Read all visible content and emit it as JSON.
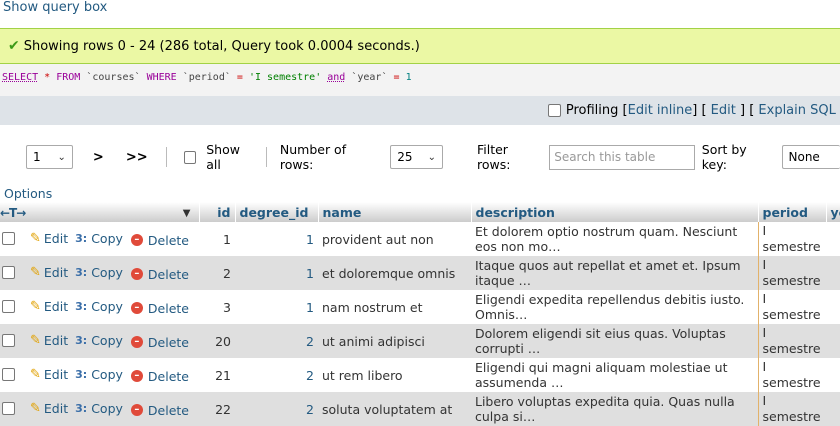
{
  "top": {
    "show_query_box": "Show query box"
  },
  "success": {
    "message": "Showing rows 0 - 24 (286 total, Query took 0.0004 seconds.)"
  },
  "sql": {
    "select": "SELECT",
    "star": "*",
    "from": "FROM",
    "table": "`courses`",
    "where": "WHERE",
    "col1": "`period`",
    "eq": "=",
    "val1": "'I semestre'",
    "and": "and",
    "col2": "`year`",
    "val2": "1"
  },
  "bar": {
    "profiling": "Profiling",
    "edit_inline": "Edit inline",
    "edit": "Edit",
    "explain": "Explain SQL"
  },
  "nav": {
    "page_value": "1",
    "next": ">",
    "last": ">>",
    "show_all": "Show all",
    "rows_label": "Number of rows:",
    "rows_value": "25",
    "filter_label": "Filter rows:",
    "filter_placeholder": "Search this table",
    "sort_label": "Sort by key:",
    "sort_value": "None"
  },
  "options_label": "Options",
  "columns": {
    "id": "id",
    "degree_id": "degree_id",
    "name": "name",
    "description": "description",
    "period": "period",
    "year": "ye"
  },
  "actions": {
    "edit": "Edit",
    "copy": "Copy",
    "delete": "Delete"
  },
  "rows": [
    {
      "id": "1",
      "degree_id": "1",
      "name": "provident aut non",
      "description": "Et dolorem optio nostrum quam. Nesciunt eos non mo…",
      "period": "I semestre"
    },
    {
      "id": "2",
      "degree_id": "1",
      "name": "et doloremque omnis",
      "description": "Itaque quos aut repellat et amet et. Ipsum itaque …",
      "period": "I semestre"
    },
    {
      "id": "3",
      "degree_id": "1",
      "name": "nam nostrum et",
      "description": "Eligendi expedita repellendus debitis iusto. Omnis…",
      "period": "I semestre"
    },
    {
      "id": "20",
      "degree_id": "2",
      "name": "ut animi adipisci",
      "description": "Dolorem eligendi sit eius quas. Voluptas corrupti …",
      "period": "I semestre"
    },
    {
      "id": "21",
      "degree_id": "2",
      "name": "ut rem libero",
      "description": "Eligendi qui magni aliquam molestiae ut assumenda …",
      "period": "I semestre"
    },
    {
      "id": "22",
      "degree_id": "2",
      "name": "soluta voluptatem at",
      "description": "Libero voluptas expedita quia. Quas nulla culpa si…",
      "period": "I semestre"
    }
  ]
}
